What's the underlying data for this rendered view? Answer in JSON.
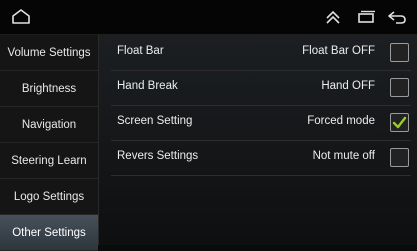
{
  "sidebar": {
    "items": [
      {
        "label": "Volume Settings"
      },
      {
        "label": "Brightness"
      },
      {
        "label": "Navigation"
      },
      {
        "label": "Steering Learn"
      },
      {
        "label": "Logo Settings"
      },
      {
        "label": "Other Settings",
        "active": true
      }
    ]
  },
  "settings": {
    "rows": [
      {
        "label": "Float Bar",
        "value": "Float Bar OFF",
        "checked": false
      },
      {
        "label": "Hand Break",
        "value": "Hand OFF",
        "checked": false
      },
      {
        "label": "Screen Setting",
        "value": "Forced mode",
        "checked": true
      },
      {
        "label": "Revers Settings",
        "value": "Not mute off",
        "checked": false
      }
    ]
  },
  "topbar": {
    "icons": [
      "home-icon",
      "chevron-up-icon",
      "recent-apps-icon",
      "back-icon"
    ]
  },
  "colors": {
    "check_accent": "#9ccc2b",
    "active_tab": "#3c464f"
  }
}
